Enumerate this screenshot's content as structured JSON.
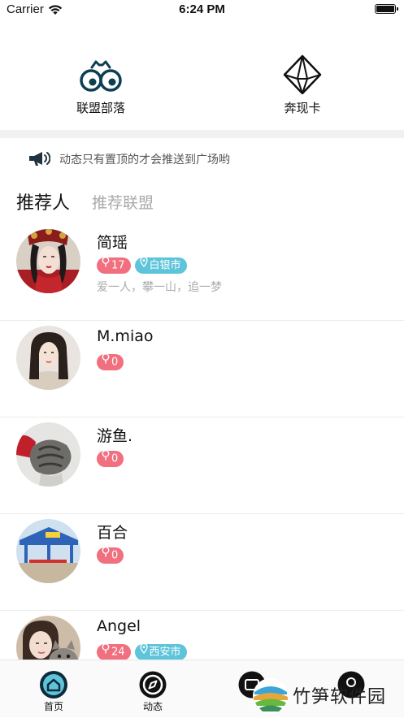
{
  "status_bar": {
    "carrier": "Carrier",
    "time": "6:24 PM"
  },
  "quick_actions": [
    {
      "label": "联盟部落",
      "icon": "binoculars-icon"
    },
    {
      "label": "奔现卡",
      "icon": "diamond-icon"
    }
  ],
  "notice": {
    "text": "动态只有置顶的才会推送到广场哟",
    "icon": "megaphone-icon"
  },
  "tabs": [
    {
      "label": "推荐人",
      "active": true
    },
    {
      "label": "推荐联盟",
      "active": false
    }
  ],
  "users": [
    {
      "name": "简瑶",
      "likes": "17",
      "city": "白银市",
      "signature": "爱一人，攀一山，追一梦"
    },
    {
      "name": "M.miao",
      "likes": "0"
    },
    {
      "name": "游鱼.",
      "likes": "0"
    },
    {
      "name": "百合",
      "likes": "0"
    },
    {
      "name": "Angel",
      "likes": "24",
      "city": "西安市"
    }
  ],
  "tab_bar": [
    {
      "label": "首页",
      "icon": "home-icon",
      "active": true
    },
    {
      "label": "动态",
      "icon": "compass-icon",
      "active": false
    },
    {
      "label": "",
      "icon": "message-icon",
      "active": false
    },
    {
      "label": "",
      "icon": "profile-icon",
      "active": false
    }
  ],
  "watermark": {
    "text": "竹笋软件园"
  },
  "colors": {
    "likes_badge": "#f0707f",
    "city_badge": "#5ec4da",
    "icon_dark": "#0d3f52"
  }
}
